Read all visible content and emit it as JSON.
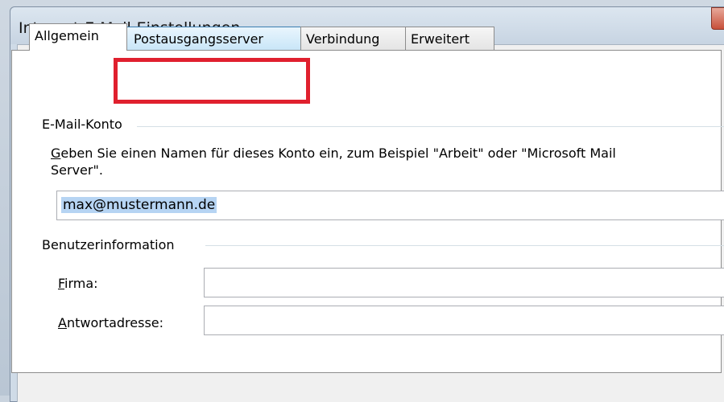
{
  "dialog": {
    "title": "Internet-E-Mail-Einstellungen"
  },
  "tabs": [
    {
      "label": "Allgemein",
      "active": true
    },
    {
      "label": "Postausgangsserver",
      "highlighted": true
    },
    {
      "label": "Verbindung"
    },
    {
      "label": "Erweitert"
    }
  ],
  "email_account": {
    "group_label": "E-Mail-Konto",
    "description_line1_accel": "G",
    "description_line1_rest": "eben Sie einen Namen für dieses Konto ein, zum Beispiel \"Arbeit\" oder \"Microsoft Mail",
    "description_line2": "Server\".",
    "account_name_value": "max@mustermann.de"
  },
  "user_info": {
    "group_label": "Benutzerinformation",
    "company_label_accel": "F",
    "company_label_rest": "irma:",
    "company_value": "",
    "reply_label_accel": "A",
    "reply_label_rest": "ntwortadresse:",
    "reply_value": ""
  },
  "colors": {
    "highlight_box": "#e0202e",
    "selection": "#b6d4f3"
  }
}
